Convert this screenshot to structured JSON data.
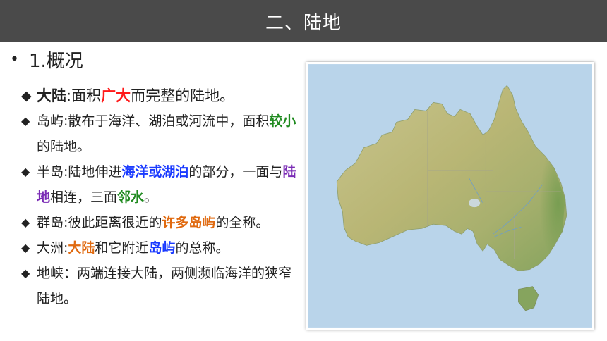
{
  "header": {
    "title": "二、陆地"
  },
  "section": {
    "bullet": "•",
    "title": "1.概况"
  },
  "colors": {
    "red": "#ff1a1a",
    "blue": "#1a3aff",
    "green": "#1f8a1f",
    "purple": "#7a2bb5",
    "orange": "#e06a10",
    "brand_dark": "#4a4a4a"
  },
  "items": [
    {
      "id": "continent",
      "marker": "◆",
      "segments": [
        {
          "text": "大陆",
          "style": "bold"
        },
        {
          "text": ":面积",
          "style": "plain"
        },
        {
          "text": "广大",
          "style": "red"
        },
        {
          "text": "而完整的陆地。",
          "style": "plain"
        }
      ]
    },
    {
      "id": "island",
      "marker": "◆",
      "segments": [
        {
          "text": "岛屿:散布于海洋、湖泊或河流中，面积",
          "style": "plain"
        },
        {
          "text": "较小",
          "style": "green"
        },
        {
          "text": "的陆地。",
          "style": "plain"
        }
      ]
    },
    {
      "id": "peninsula",
      "marker": "◆",
      "segments": [
        {
          "text": "半岛:陆地伸进",
          "style": "plain"
        },
        {
          "text": "海洋或湖泊",
          "style": "blue"
        },
        {
          "text": "的部分，一面与",
          "style": "plain"
        },
        {
          "text": "陆地",
          "style": "purple"
        },
        {
          "text": "相连，三面",
          "style": "plain"
        },
        {
          "text": "邻水",
          "style": "green"
        },
        {
          "text": "。",
          "style": "plain"
        }
      ]
    },
    {
      "id": "archipelago",
      "marker": "◆",
      "segments": [
        {
          "text": "群岛:彼此距离很近的",
          "style": "plain"
        },
        {
          "text": "许多岛屿",
          "style": "orange"
        },
        {
          "text": "的全称。",
          "style": "plain"
        }
      ]
    },
    {
      "id": "continent-islands",
      "marker": "◆",
      "segments": [
        {
          "text": "大洲:",
          "style": "plain"
        },
        {
          "text": "大陆",
          "style": "orange"
        },
        {
          "text": "和它附近",
          "style": "plain"
        },
        {
          "text": "岛屿",
          "style": "blue"
        },
        {
          "text": "的总称。",
          "style": "plain"
        }
      ]
    },
    {
      "id": "isthmus",
      "marker": "◆",
      "segments": [
        {
          "text": "地峡：两端连接大陆，两侧濒临海洋的狭窄陆地。",
          "style": "plain"
        }
      ]
    }
  ],
  "map": {
    "subject": "Australia relief map",
    "ocean_color": "#b8d3ea",
    "land_color": "#c9c58e"
  }
}
